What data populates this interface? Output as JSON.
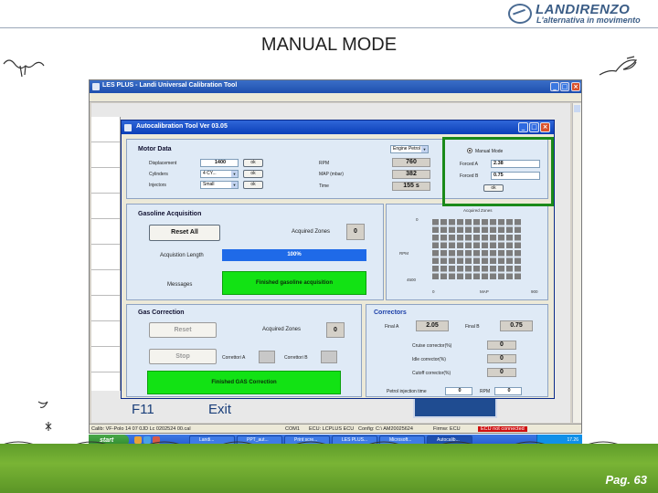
{
  "brand": {
    "name": "LANDIRENZO",
    "tagline": "L'alternativa in movimento"
  },
  "slide": {
    "title": "MANUAL MODE",
    "page": "Pag. 63"
  },
  "main_window": {
    "title": "LES PLUS - Landi Universal Calibration Tool",
    "background_keys": {
      "f11": "F11",
      "exit": "Exit"
    },
    "status": [
      "Calib: VF-Polo 14 07 0JD Lc 0202524 00.cal",
      "COM1",
      "ECU: LCPLUS ECU",
      "Config: C:\\ AM20025624",
      "Firmw: ECU",
      "ECU not connected"
    ]
  },
  "dialog": {
    "title": "Autocalibration Tool Ver 03.05",
    "motor_data": {
      "heading": "Motor Data",
      "displacement_label": "Displacement",
      "displacement_value": "1400",
      "cylinders_label": "Cylinders",
      "cylinders_value": "4 CY...",
      "injectors_label": "Injectors",
      "injectors_value": "Small",
      "ok_label": "ok",
      "engine_select": "Engine Petrol",
      "rpm_label": "RPM",
      "rpm_value": "760",
      "map_label": "MAP (mbar)",
      "map_value": "382",
      "time_label": "Time",
      "time_value": "155 s"
    },
    "manual_mode": {
      "radio_label": "Manual Mode",
      "forced_a_label": "Forced A",
      "forced_a_value": "2.38",
      "forced_b_label": "Forced B",
      "forced_b_value": "0.75",
      "ok_label": "ok"
    },
    "gasoline": {
      "heading": "Gasoline Acquisition",
      "reset_label": "Reset All",
      "acquired_label": "Acquired Zones",
      "acquired_value": "0",
      "length_label": "Acquistion Length",
      "progress_percent": 100,
      "progress_text": "100%",
      "messages_label": "Messages",
      "message": "Finished gasoline acquisition"
    },
    "zones_chart": {
      "title": "Acquired Zones",
      "ylabel": "RPM",
      "xlabel": "MAP",
      "y_top": "0",
      "y_bottom": "4500",
      "x_left": "0",
      "x_right": "900"
    },
    "gas": {
      "heading": "Gas Correction",
      "reset_label": "Reset",
      "acquired_label": "Acquired Zones",
      "acquired_value": "0",
      "stop_label": "Stop",
      "corr_a_label": "Correttori A",
      "corr_b_label": "Correttori B",
      "message": "Finished GAS Correction"
    },
    "correctors": {
      "heading": "Correctors",
      "final_a_label": "Final A",
      "final_a_value": "2.05",
      "final_b_label": "Final B",
      "final_b_value": "0.75",
      "cruise_label": "Cruise corrector(%)",
      "cruise_value": "0",
      "idle_label": "Idle corrector(%)",
      "idle_value": "0",
      "cutoff_label": "Cutoff corrector(%)",
      "cutoff_value": "0",
      "petrol_label": "Petrol injection time",
      "petrol_value": "0",
      "rpm_label": "RPM",
      "rpm_value": "0"
    }
  },
  "taskbar": {
    "start": "start",
    "tasks": [
      "Landi...",
      "PPT_aut...",
      "Print scre...",
      "LES PLUS...",
      "Microsoft...",
      "Autocalib..."
    ],
    "clock": "17.26"
  }
}
